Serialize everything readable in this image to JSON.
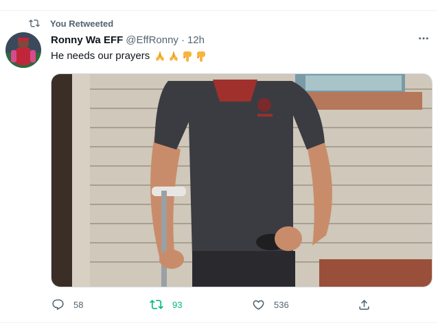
{
  "context": {
    "retweet_label": "You Retweeted",
    "icon": "retweet-icon"
  },
  "tweet": {
    "display_name": "Ronny Wa EFF",
    "handle": "@EffRonny",
    "separator": "·",
    "time": "12h",
    "text": "He needs our prayers",
    "emojis": [
      "folded-hands",
      "folded-hands",
      "backhand-index-pointing-down",
      "backhand-index-pointing-down"
    ],
    "more_icon": "more-horizontal-icon"
  },
  "actions": {
    "reply_count": "58",
    "retweet_count": "93",
    "like_count": "536",
    "retweet_active": true
  },
  "colors": {
    "accent_retweet": "#00ba7c",
    "secondary_text": "#536471",
    "primary_text": "#0f1419"
  }
}
